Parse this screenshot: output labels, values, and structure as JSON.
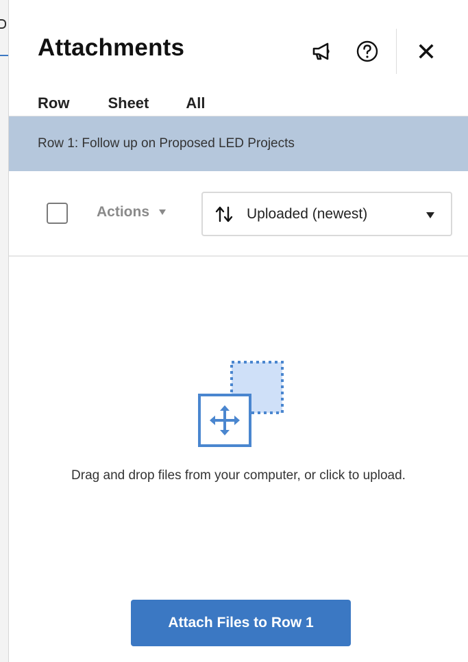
{
  "panel": {
    "title": "Attachments",
    "header_icons": [
      "megaphone-icon",
      "help-icon",
      "close-icon"
    ]
  },
  "tabs": [
    {
      "label": "Row",
      "active": true
    },
    {
      "label": "Sheet",
      "active": false
    },
    {
      "label": "All",
      "active": false
    }
  ],
  "row_banner": {
    "text": "Row 1: Follow up on Proposed LED Projects"
  },
  "toolbar": {
    "select_all_checked": false,
    "actions_label": "Actions",
    "sort": {
      "icon": "sort-arrows-icon",
      "selected": "Uploaded (newest)"
    }
  },
  "dropzone": {
    "icon": "drag-drop-move-icon",
    "text": "Drag and drop files from your computer, or click to upload."
  },
  "attach_button": {
    "label": "Attach Files to Row 1"
  },
  "colors": {
    "accent": "#3b78c3",
    "banner": "#b5c7dc",
    "drop_icon_fill": "#cfe0f8"
  }
}
